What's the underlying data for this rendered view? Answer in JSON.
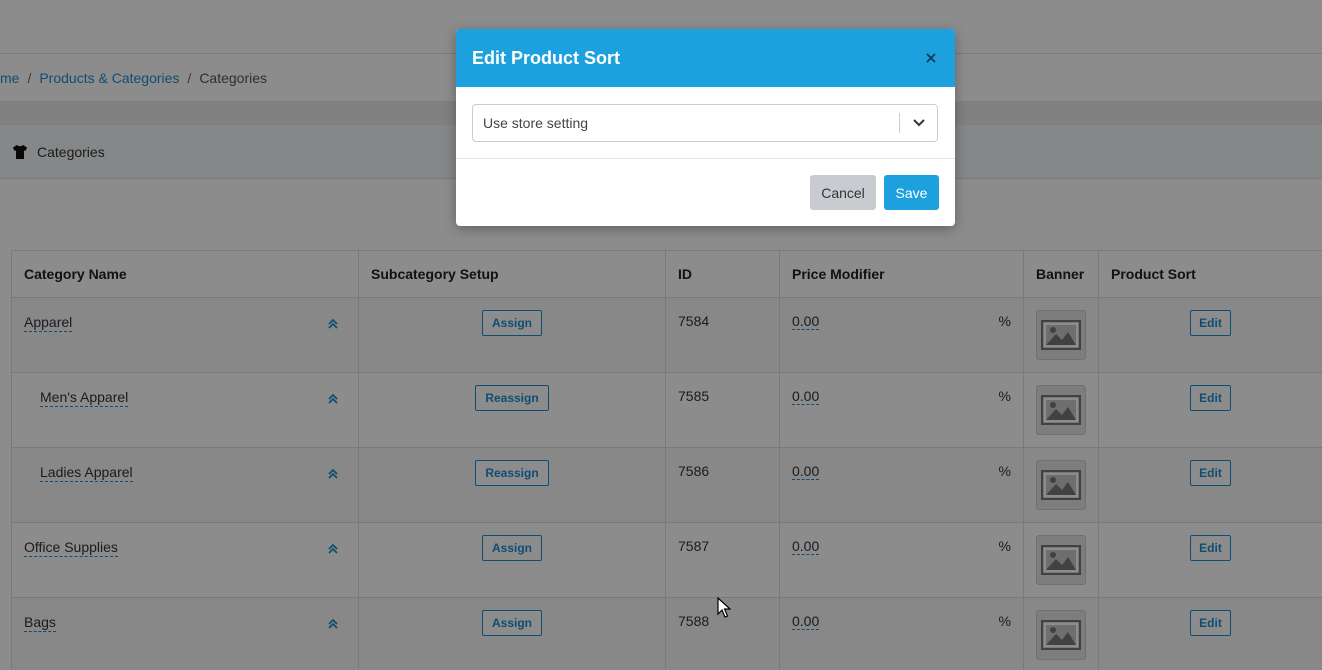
{
  "breadcrumb": {
    "items": [
      {
        "label": "me",
        "link": true
      },
      {
        "label": "Products & Categories",
        "link": true
      },
      {
        "label": "Categories",
        "link": false
      }
    ],
    "separator": "/"
  },
  "panel": {
    "title": "Categories",
    "icon": "shirt-icon"
  },
  "table": {
    "headers": [
      "Category Name",
      "Subcategory Setup",
      "ID",
      "Price Modifier",
      "Banner",
      "Product Sort"
    ],
    "rows": [
      {
        "name": "Apparel",
        "sub": false,
        "setup": "Assign",
        "id": "7584",
        "price": "0.00",
        "unit": "%",
        "sort": "Edit"
      },
      {
        "name": "Men's Apparel",
        "sub": true,
        "setup": "Reassign",
        "id": "7585",
        "price": "0.00",
        "unit": "%",
        "sort": "Edit"
      },
      {
        "name": "Ladies Apparel",
        "sub": true,
        "setup": "Reassign",
        "id": "7586",
        "price": "0.00",
        "unit": "%",
        "sort": "Edit"
      },
      {
        "name": "Office Supplies",
        "sub": false,
        "setup": "Assign",
        "id": "7587",
        "price": "0.00",
        "unit": "%",
        "sort": "Edit"
      },
      {
        "name": "Bags",
        "sub": false,
        "setup": "Assign",
        "id": "7588",
        "price": "0.00",
        "unit": "%",
        "sort": "Edit"
      }
    ]
  },
  "modal": {
    "title": "Edit Product Sort",
    "close_icon": "close-icon",
    "select_value": "Use store setting",
    "cancel_label": "Cancel",
    "save_label": "Save"
  },
  "colors": {
    "accent": "#1da1de",
    "link": "#1c8fd1"
  }
}
